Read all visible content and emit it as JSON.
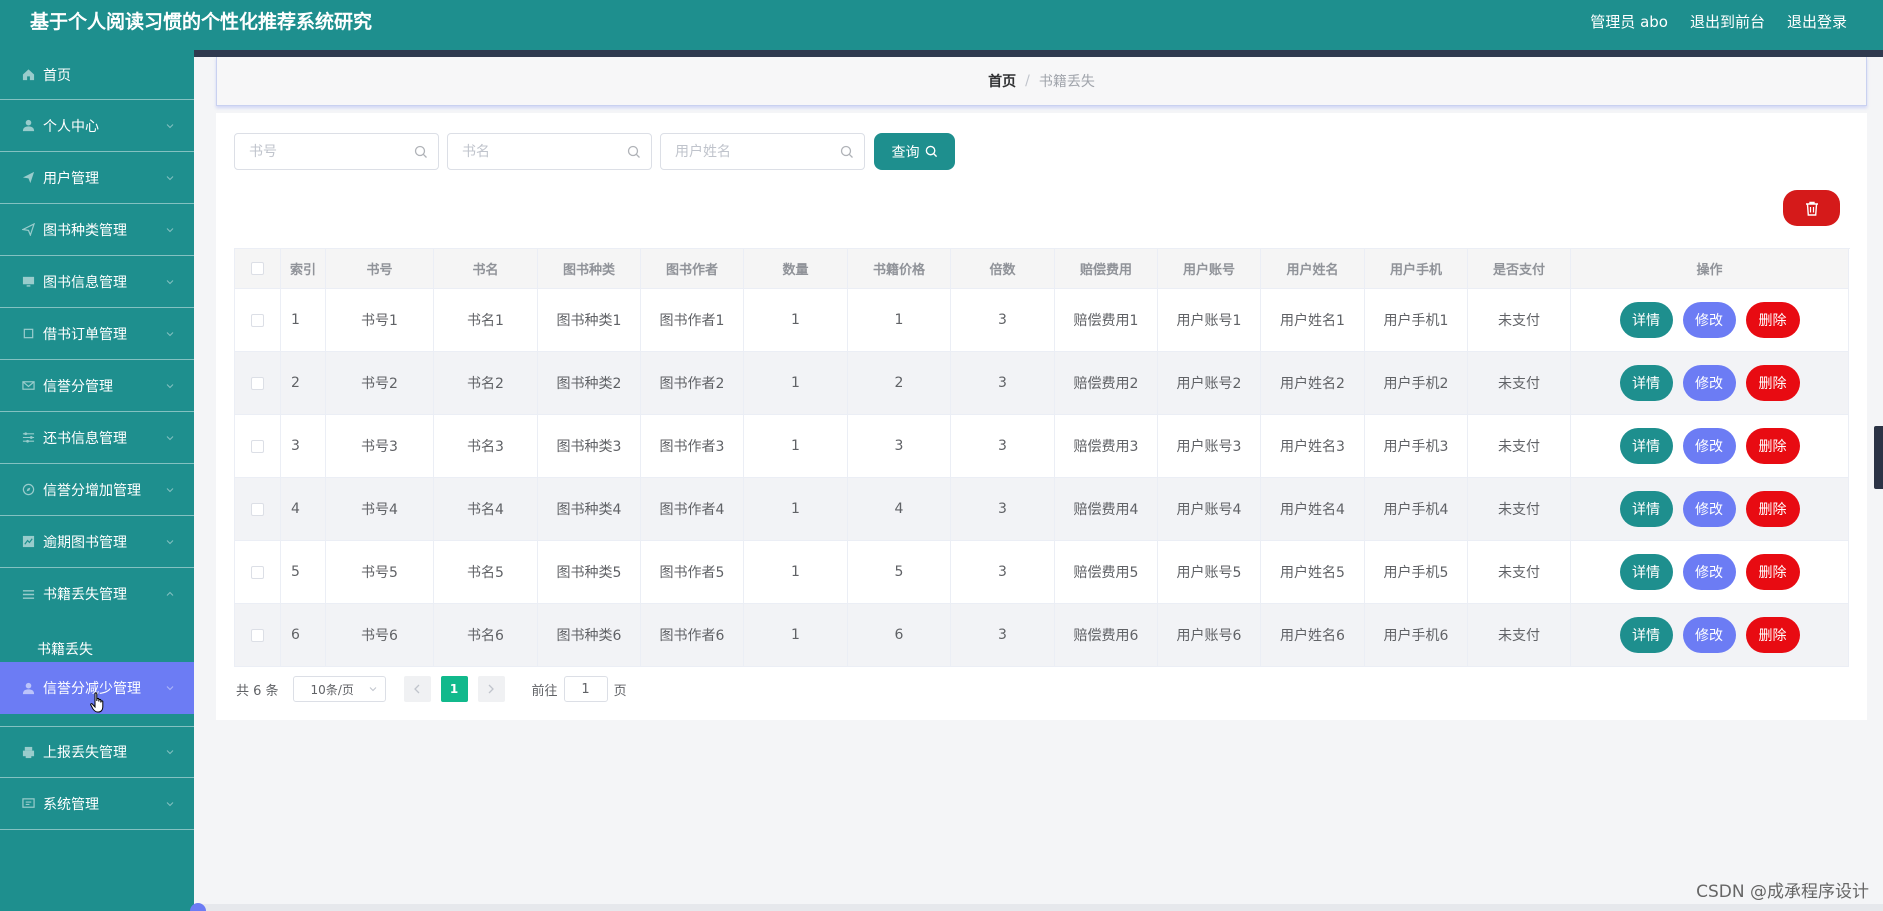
{
  "header": {
    "title": "基于个人阅读习惯的个性化推荐系统研究",
    "user_label": "管理员 abo",
    "front_label": "退出到前台",
    "logout_label": "退出登录"
  },
  "sidebar": {
    "items": [
      {
        "label": "首页",
        "icon": "home-icon"
      },
      {
        "label": "个人中心",
        "icon": "user-icon"
      },
      {
        "label": "用户管理",
        "icon": "send-icon"
      },
      {
        "label": "图书种类管理",
        "icon": "send-outline-icon"
      },
      {
        "label": "图书信息管理",
        "icon": "monitor-icon"
      },
      {
        "label": "借书订单管理",
        "icon": "crop-icon"
      },
      {
        "label": "信誉分管理",
        "icon": "mail-icon"
      },
      {
        "label": "还书信息管理",
        "icon": "sliders-icon"
      },
      {
        "label": "信誉分增加管理",
        "icon": "compass-icon"
      },
      {
        "label": "逾期图书管理",
        "icon": "chart-icon"
      },
      {
        "label": "书籍丢失管理",
        "icon": "list-icon"
      },
      {
        "label": "信誉分减少管理",
        "icon": "user-icon"
      },
      {
        "label": "上报丢失管理",
        "icon": "printer-icon"
      },
      {
        "label": "系统管理",
        "icon": "message-icon"
      }
    ],
    "submenu_label": "书籍丢失"
  },
  "breadcrumb": {
    "home": "首页",
    "separator": "/",
    "current": "书籍丢失"
  },
  "search": {
    "book_no_placeholder": "书号",
    "book_name_placeholder": "书名",
    "user_name_placeholder": "用户姓名",
    "query_label": "查询"
  },
  "table": {
    "headers": [
      "索引",
      "书号",
      "书名",
      "图书种类",
      "图书作者",
      "数量",
      "书籍价格",
      "倍数",
      "赔偿费用",
      "用户账号",
      "用户姓名",
      "用户手机",
      "是否支付",
      "操作"
    ],
    "rows": [
      [
        "1",
        "书号1",
        "书名1",
        "图书种类1",
        "图书作者1",
        "1",
        "1",
        "3",
        "赔偿费用1",
        "用户账号1",
        "用户姓名1",
        "用户手机1",
        "未支付"
      ],
      [
        "2",
        "书号2",
        "书名2",
        "图书种类2",
        "图书作者2",
        "1",
        "2",
        "3",
        "赔偿费用2",
        "用户账号2",
        "用户姓名2",
        "用户手机2",
        "未支付"
      ],
      [
        "3",
        "书号3",
        "书名3",
        "图书种类3",
        "图书作者3",
        "1",
        "3",
        "3",
        "赔偿费用3",
        "用户账号3",
        "用户姓名3",
        "用户手机3",
        "未支付"
      ],
      [
        "4",
        "书号4",
        "书名4",
        "图书种类4",
        "图书作者4",
        "1",
        "4",
        "3",
        "赔偿费用4",
        "用户账号4",
        "用户姓名4",
        "用户手机4",
        "未支付"
      ],
      [
        "5",
        "书号5",
        "书名5",
        "图书种类5",
        "图书作者5",
        "1",
        "5",
        "3",
        "赔偿费用5",
        "用户账号5",
        "用户姓名5",
        "用户手机5",
        "未支付"
      ],
      [
        "6",
        "书号6",
        "书名6",
        "图书种类6",
        "图书作者6",
        "1",
        "6",
        "3",
        "赔偿费用6",
        "用户账号6",
        "用户姓名6",
        "用户手机6",
        "未支付"
      ]
    ],
    "actions": {
      "detail": "详情",
      "edit": "修改",
      "delete": "删除"
    }
  },
  "pagination": {
    "total": "共 6 条",
    "page_size": "10条/页",
    "current_page": "1",
    "goto_prefix": "前往",
    "goto_value": "1",
    "goto_suffix": "页"
  },
  "watermark": "CSDN @成承程序设计",
  "colors": {
    "primary": "#1e8f8e",
    "accent": "#6c7cf4",
    "danger": "#e80b12",
    "page_active": "#11b98c"
  }
}
